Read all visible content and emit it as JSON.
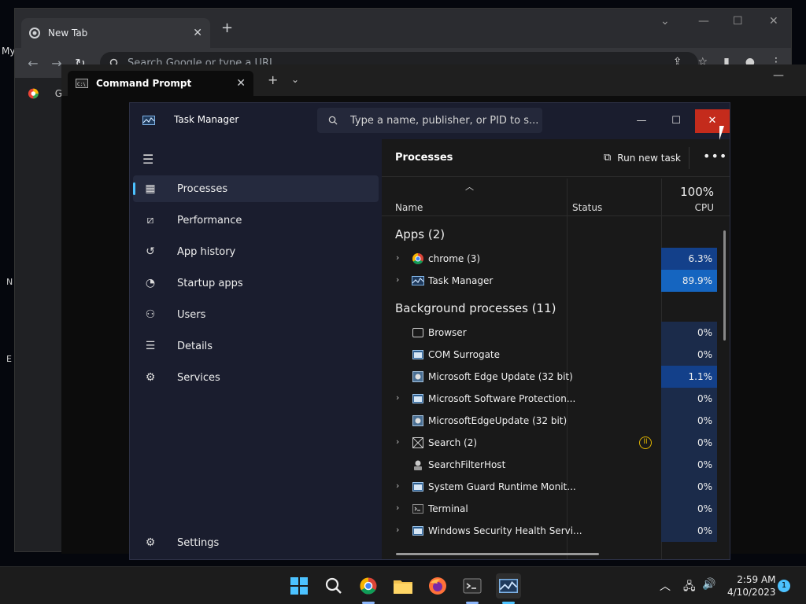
{
  "desktop": {
    "label": "My",
    "side_labels": [
      "N",
      "E"
    ]
  },
  "chrome": {
    "tab_title": "New Tab",
    "omnibox_placeholder": "Search Google or type a URL",
    "bookmark_label": "G"
  },
  "cmd": {
    "tab_title": "Command Prompt"
  },
  "taskmgr": {
    "title": "Task Manager",
    "search_placeholder": "Type a name, publisher, or PID to s...",
    "nav": [
      {
        "label": "Processes",
        "icon": "processes-icon"
      },
      {
        "label": "Performance",
        "icon": "performance-icon"
      },
      {
        "label": "App history",
        "icon": "app-history-icon"
      },
      {
        "label": "Startup apps",
        "icon": "startup-apps-icon"
      },
      {
        "label": "Users",
        "icon": "users-icon"
      },
      {
        "label": "Details",
        "icon": "details-icon"
      },
      {
        "label": "Services",
        "icon": "services-icon"
      }
    ],
    "settings_label": "Settings",
    "main_title": "Processes",
    "run_task_label": "Run new task",
    "columns": {
      "name": "Name",
      "status": "Status",
      "cpu_pct": "100%",
      "cpu": "CPU"
    },
    "apps_group": "Apps (2)",
    "apps": [
      {
        "name": "chrome (3)",
        "cpu": "6.3%",
        "expandable": true,
        "icon": "chrome-icon"
      },
      {
        "name": "Task Manager",
        "cpu": "89.9%",
        "expandable": true,
        "icon": "task-manager-icon"
      }
    ],
    "bg_group": "Background processes (11)",
    "background": [
      {
        "name": "Browser",
        "cpu": "0%",
        "expandable": false,
        "icon": "window-icon"
      },
      {
        "name": "COM Surrogate",
        "cpu": "0%",
        "expandable": false,
        "icon": "app-window-icon"
      },
      {
        "name": "Microsoft Edge Update (32 bit)",
        "cpu": "1.1%",
        "expandable": false,
        "icon": "edge-update-icon"
      },
      {
        "name": "Microsoft Software Protection...",
        "cpu": "0%",
        "expandable": true,
        "icon": "app-window-icon"
      },
      {
        "name": "MicrosoftEdgeUpdate (32 bit)",
        "cpu": "0%",
        "expandable": false,
        "icon": "edge-update-icon"
      },
      {
        "name": "Search (2)",
        "cpu": "0%",
        "expandable": true,
        "icon": "search-process-icon",
        "status": "suspended"
      },
      {
        "name": "SearchFilterHost",
        "cpu": "0%",
        "expandable": false,
        "icon": "search-filter-icon"
      },
      {
        "name": "System Guard Runtime Monit...",
        "cpu": "0%",
        "expandable": true,
        "icon": "app-window-icon"
      },
      {
        "name": "Terminal",
        "cpu": "0%",
        "expandable": true,
        "icon": "terminal-icon"
      },
      {
        "name": "Windows Security Health Servi...",
        "cpu": "0%",
        "expandable": true,
        "icon": "app-window-icon"
      }
    ]
  },
  "taskbar": {
    "time": "2:59 AM",
    "date": "4/10/2023",
    "notifications": "1"
  },
  "colors": {
    "accent": "#4cc2ff",
    "close_red": "#c42b1c",
    "cpu_high": "#1565c0",
    "cpu_mid": "#13408a",
    "cpu_low": "#1b2b4a"
  }
}
